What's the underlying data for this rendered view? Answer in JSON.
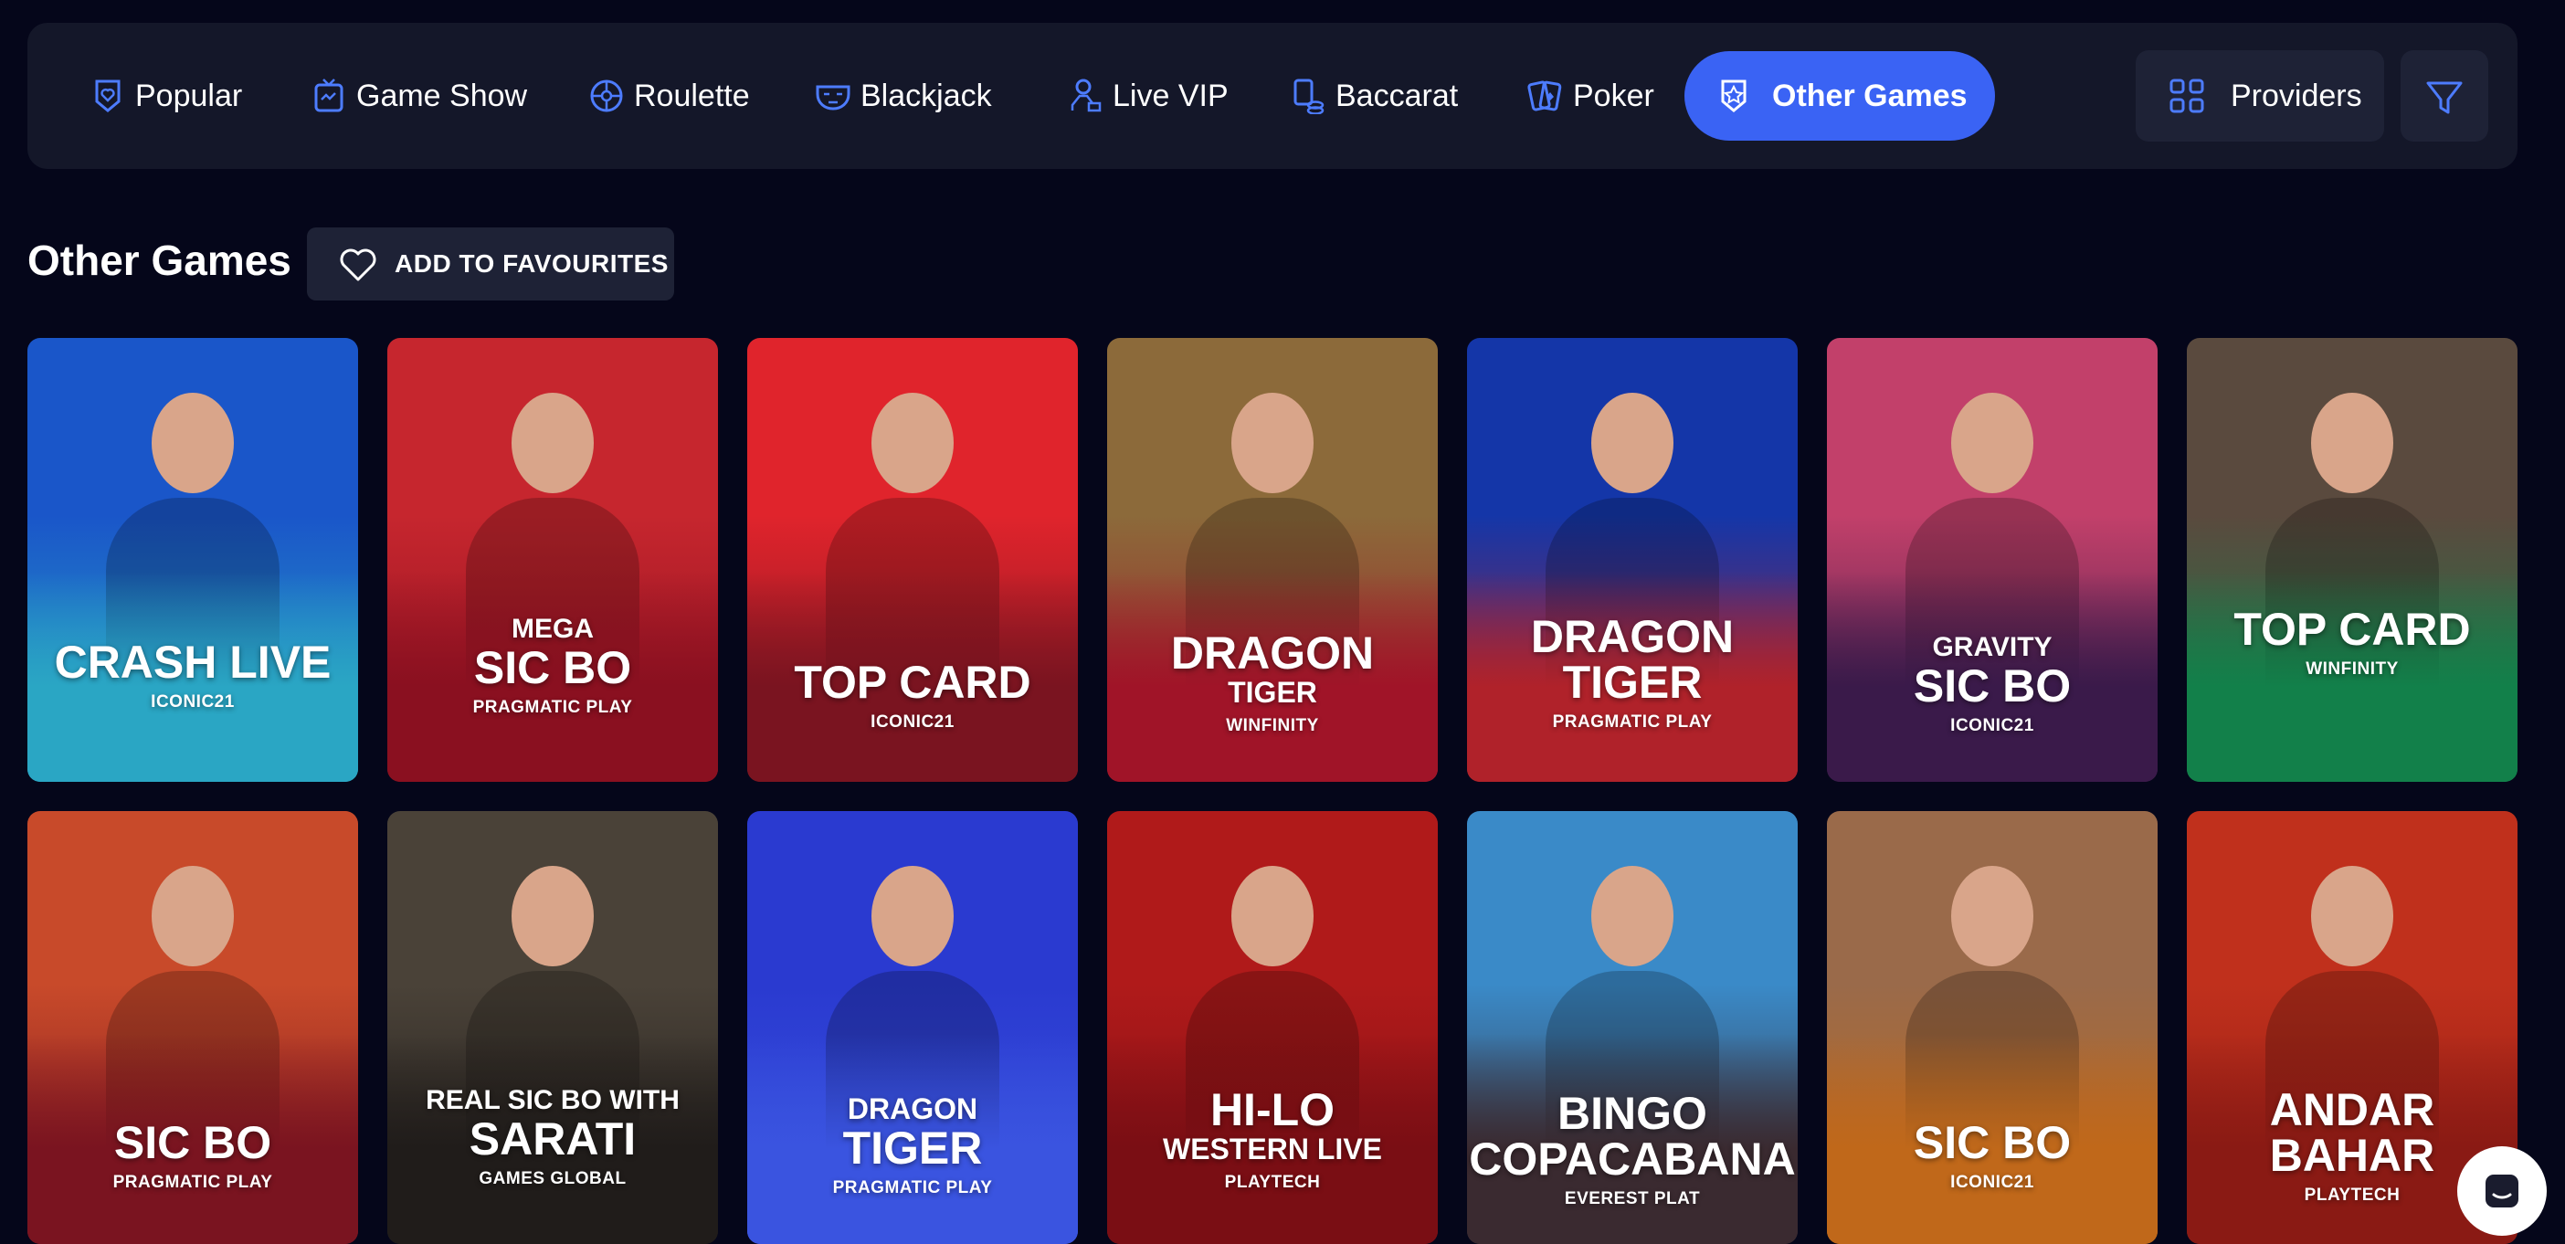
{
  "nav": {
    "items": [
      {
        "label": "Popular",
        "icon": "heart-badge-icon"
      },
      {
        "label": "Game Show",
        "icon": "tv-icon"
      },
      {
        "label": "Roulette",
        "icon": "roulette-wheel-icon"
      },
      {
        "label": "Blackjack",
        "icon": "mask-icon"
      },
      {
        "label": "Live VIP",
        "icon": "dealer-icon"
      },
      {
        "label": "Baccarat",
        "icon": "card-chips-icon"
      },
      {
        "label": "Poker",
        "icon": "poker-cards-icon"
      },
      {
        "label": "Other Games",
        "icon": "star-badge-icon",
        "active": true
      }
    ],
    "providers_label": "Providers",
    "accent": "#3a63f4"
  },
  "section": {
    "title": "Other Games",
    "favourite_label": "ADD TO FAVOURITES"
  },
  "games": [
    {
      "sup": "",
      "title": "CRASH LIVE",
      "sub": "",
      "provider": "ICONIC21",
      "colors": [
        "#1a56c9",
        "#2aa6c4"
      ]
    },
    {
      "sup": "MEGA",
      "title": "SIC BO",
      "sub": "",
      "provider": "PRAGMATIC PLAY",
      "colors": [
        "#c6262e",
        "#8a1020"
      ]
    },
    {
      "sup": "",
      "title": "TOP CARD",
      "sub": "",
      "provider": "ICONIC21",
      "colors": [
        "#e0242c",
        "#7a1420"
      ]
    },
    {
      "sup": "",
      "title": "DRAGON",
      "sub": "TIGER",
      "provider": "WINFINITY",
      "colors": [
        "#8c6a3a",
        "#a01428"
      ]
    },
    {
      "sup": "",
      "title": "DRAGON TIGER",
      "sub": "",
      "provider": "PRAGMATIC PLAY",
      "colors": [
        "#1436a8",
        "#b0222a"
      ]
    },
    {
      "sup": "GRAVITY",
      "title": "SIC BO",
      "sub": "",
      "provider": "ICONIC21",
      "colors": [
        "#c2406a",
        "#3a1a4a"
      ]
    },
    {
      "sup": "",
      "title": "TOP CARD",
      "sub": "",
      "provider": "WINFINITY",
      "colors": [
        "#5a4a3e",
        "#12804a"
      ]
    },
    {
      "sup": "",
      "title": "SIC BO",
      "sub": "",
      "provider": "PRAGMATIC PLAY",
      "colors": [
        "#c84a2a",
        "#7a1420"
      ]
    },
    {
      "sup": "REAL SIC BO WITH",
      "title": "SARATI",
      "sub": "",
      "provider": "GAMES GLOBAL",
      "colors": [
        "#4a4238",
        "#201c1a"
      ]
    },
    {
      "sup": "",
      "title": "TIGER",
      "sub": "",
      "pre": "DRAGON",
      "provider": "PRAGMATIC PLAY",
      "colors": [
        "#2a3ad0",
        "#3a54e0"
      ]
    },
    {
      "sup": "",
      "title": "HI-LO",
      "sub": "WESTERN LIVE",
      "provider": "PLAYTECH",
      "colors": [
        "#b01a1a",
        "#7a0e14"
      ]
    },
    {
      "sup": "",
      "title": "BINGO COPACABANA",
      "sub": "",
      "provider": "EVEREST PLAT",
      "colors": [
        "#3a8ac8",
        "#3a2a30"
      ]
    },
    {
      "sup": "",
      "title": "SIC BO",
      "sub": "",
      "provider": "ICONIC21",
      "colors": [
        "#9a6a4a",
        "#c0681a"
      ]
    },
    {
      "sup": "",
      "title": "ANDAR BAHAR",
      "sub": "",
      "provider": "PLAYTECH",
      "colors": [
        "#c0301c",
        "#8a1a14"
      ]
    }
  ]
}
